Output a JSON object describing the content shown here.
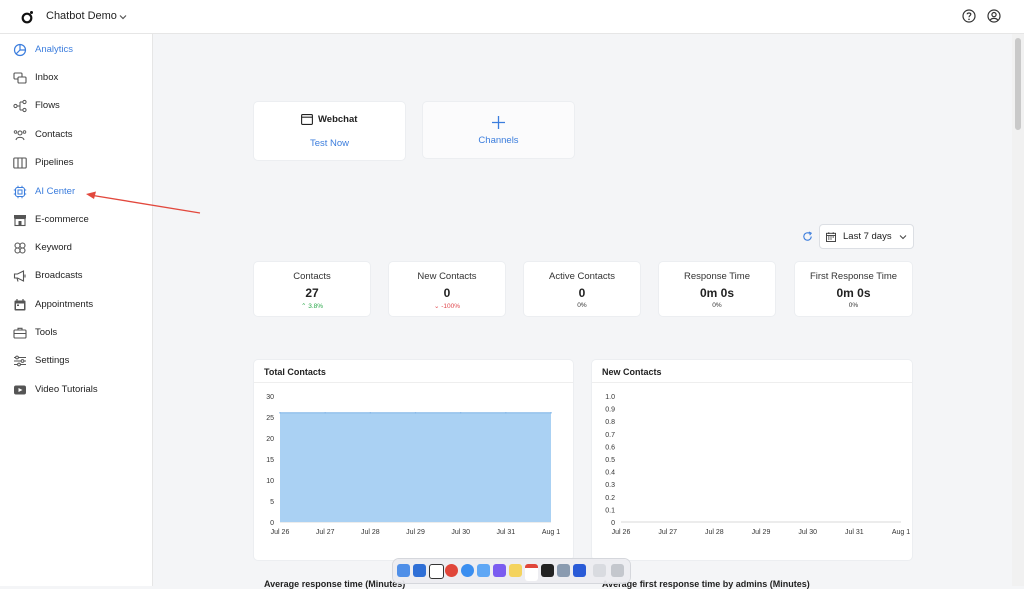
{
  "header": {
    "app_name": "Chatbot Demo",
    "icons": [
      "workspace-logo-icon",
      "chevron-down-icon",
      "help-icon",
      "account-icon"
    ]
  },
  "sidebar": {
    "items": [
      {
        "label": "Analytics",
        "icon": "analytics-icon",
        "state": "active"
      },
      {
        "label": "Inbox",
        "icon": "inbox-icon"
      },
      {
        "label": "Flows",
        "icon": "flows-icon"
      },
      {
        "label": "Contacts",
        "icon": "contacts-icon"
      },
      {
        "label": "Pipelines",
        "icon": "pipelines-icon"
      },
      {
        "label": "AI Center",
        "icon": "ai-chip-icon",
        "state": "highlighted"
      },
      {
        "label": "E-commerce",
        "icon": "store-icon"
      },
      {
        "label": "Keyword",
        "icon": "keyword-icon"
      },
      {
        "label": "Broadcasts",
        "icon": "megaphone-icon"
      },
      {
        "label": "Appointments",
        "icon": "calendar-icon"
      },
      {
        "label": "Tools",
        "icon": "toolbox-icon"
      },
      {
        "label": "Settings",
        "icon": "sliders-icon"
      },
      {
        "label": "Video Tutorials",
        "icon": "video-icon"
      }
    ]
  },
  "channels": {
    "webchat": {
      "title": "Webchat",
      "action": "Test Now"
    },
    "add": {
      "label": "Channels",
      "icon": "plus-icon"
    }
  },
  "filter": {
    "range": "Last 7 days",
    "icons": [
      "refresh-icon",
      "calendar-icon",
      "chevron-down-icon"
    ]
  },
  "stats": [
    {
      "title": "Contacts",
      "value": "27",
      "change": "3.8%",
      "trend": "up"
    },
    {
      "title": "New Contacts",
      "value": "0",
      "change": "-100%",
      "trend": "down"
    },
    {
      "title": "Active Contacts",
      "value": "0",
      "change": "0%"
    },
    {
      "title": "Response Time",
      "value": "0m 0s",
      "change": "0%"
    },
    {
      "title": "First Response Time",
      "value": "0m 0s",
      "change": "0%"
    }
  ],
  "colors": {
    "accent": "#3b7ddd",
    "up": "#2aa84a",
    "down": "#e0474c",
    "area_fill": "#aad1f3",
    "area_line": "#86b8e8",
    "annotation": "#e2483d"
  },
  "chart_data": [
    {
      "type": "area",
      "title": "Total Contacts",
      "x": [
        "Jul 26",
        "Jul 27",
        "Jul 28",
        "Jul 29",
        "Jul 30",
        "Jul 31",
        "Aug 1"
      ],
      "values": [
        26,
        26,
        26,
        26,
        26,
        26,
        26
      ],
      "y_ticks": [
        "0",
        "5",
        "10",
        "15",
        "20",
        "25",
        "30"
      ],
      "ylim": [
        0,
        30
      ],
      "grid": false
    },
    {
      "type": "line",
      "title": "New Contacts",
      "x": [
        "Jul 26",
        "Jul 27",
        "Jul 28",
        "Jul 29",
        "Jul 30",
        "Jul 31",
        "Aug 1"
      ],
      "values": [],
      "y_ticks": [
        "0",
        "0.1",
        "0.2",
        "0.3",
        "0.4",
        "0.5",
        "0.6",
        "0.7",
        "0.8",
        "0.9",
        "1.0"
      ],
      "ylim": [
        0,
        1
      ],
      "grid": false
    }
  ],
  "bottom": {
    "left_title": "Average response time (Minutes)",
    "right_title": "Average first response time by admins (Minutes)"
  }
}
